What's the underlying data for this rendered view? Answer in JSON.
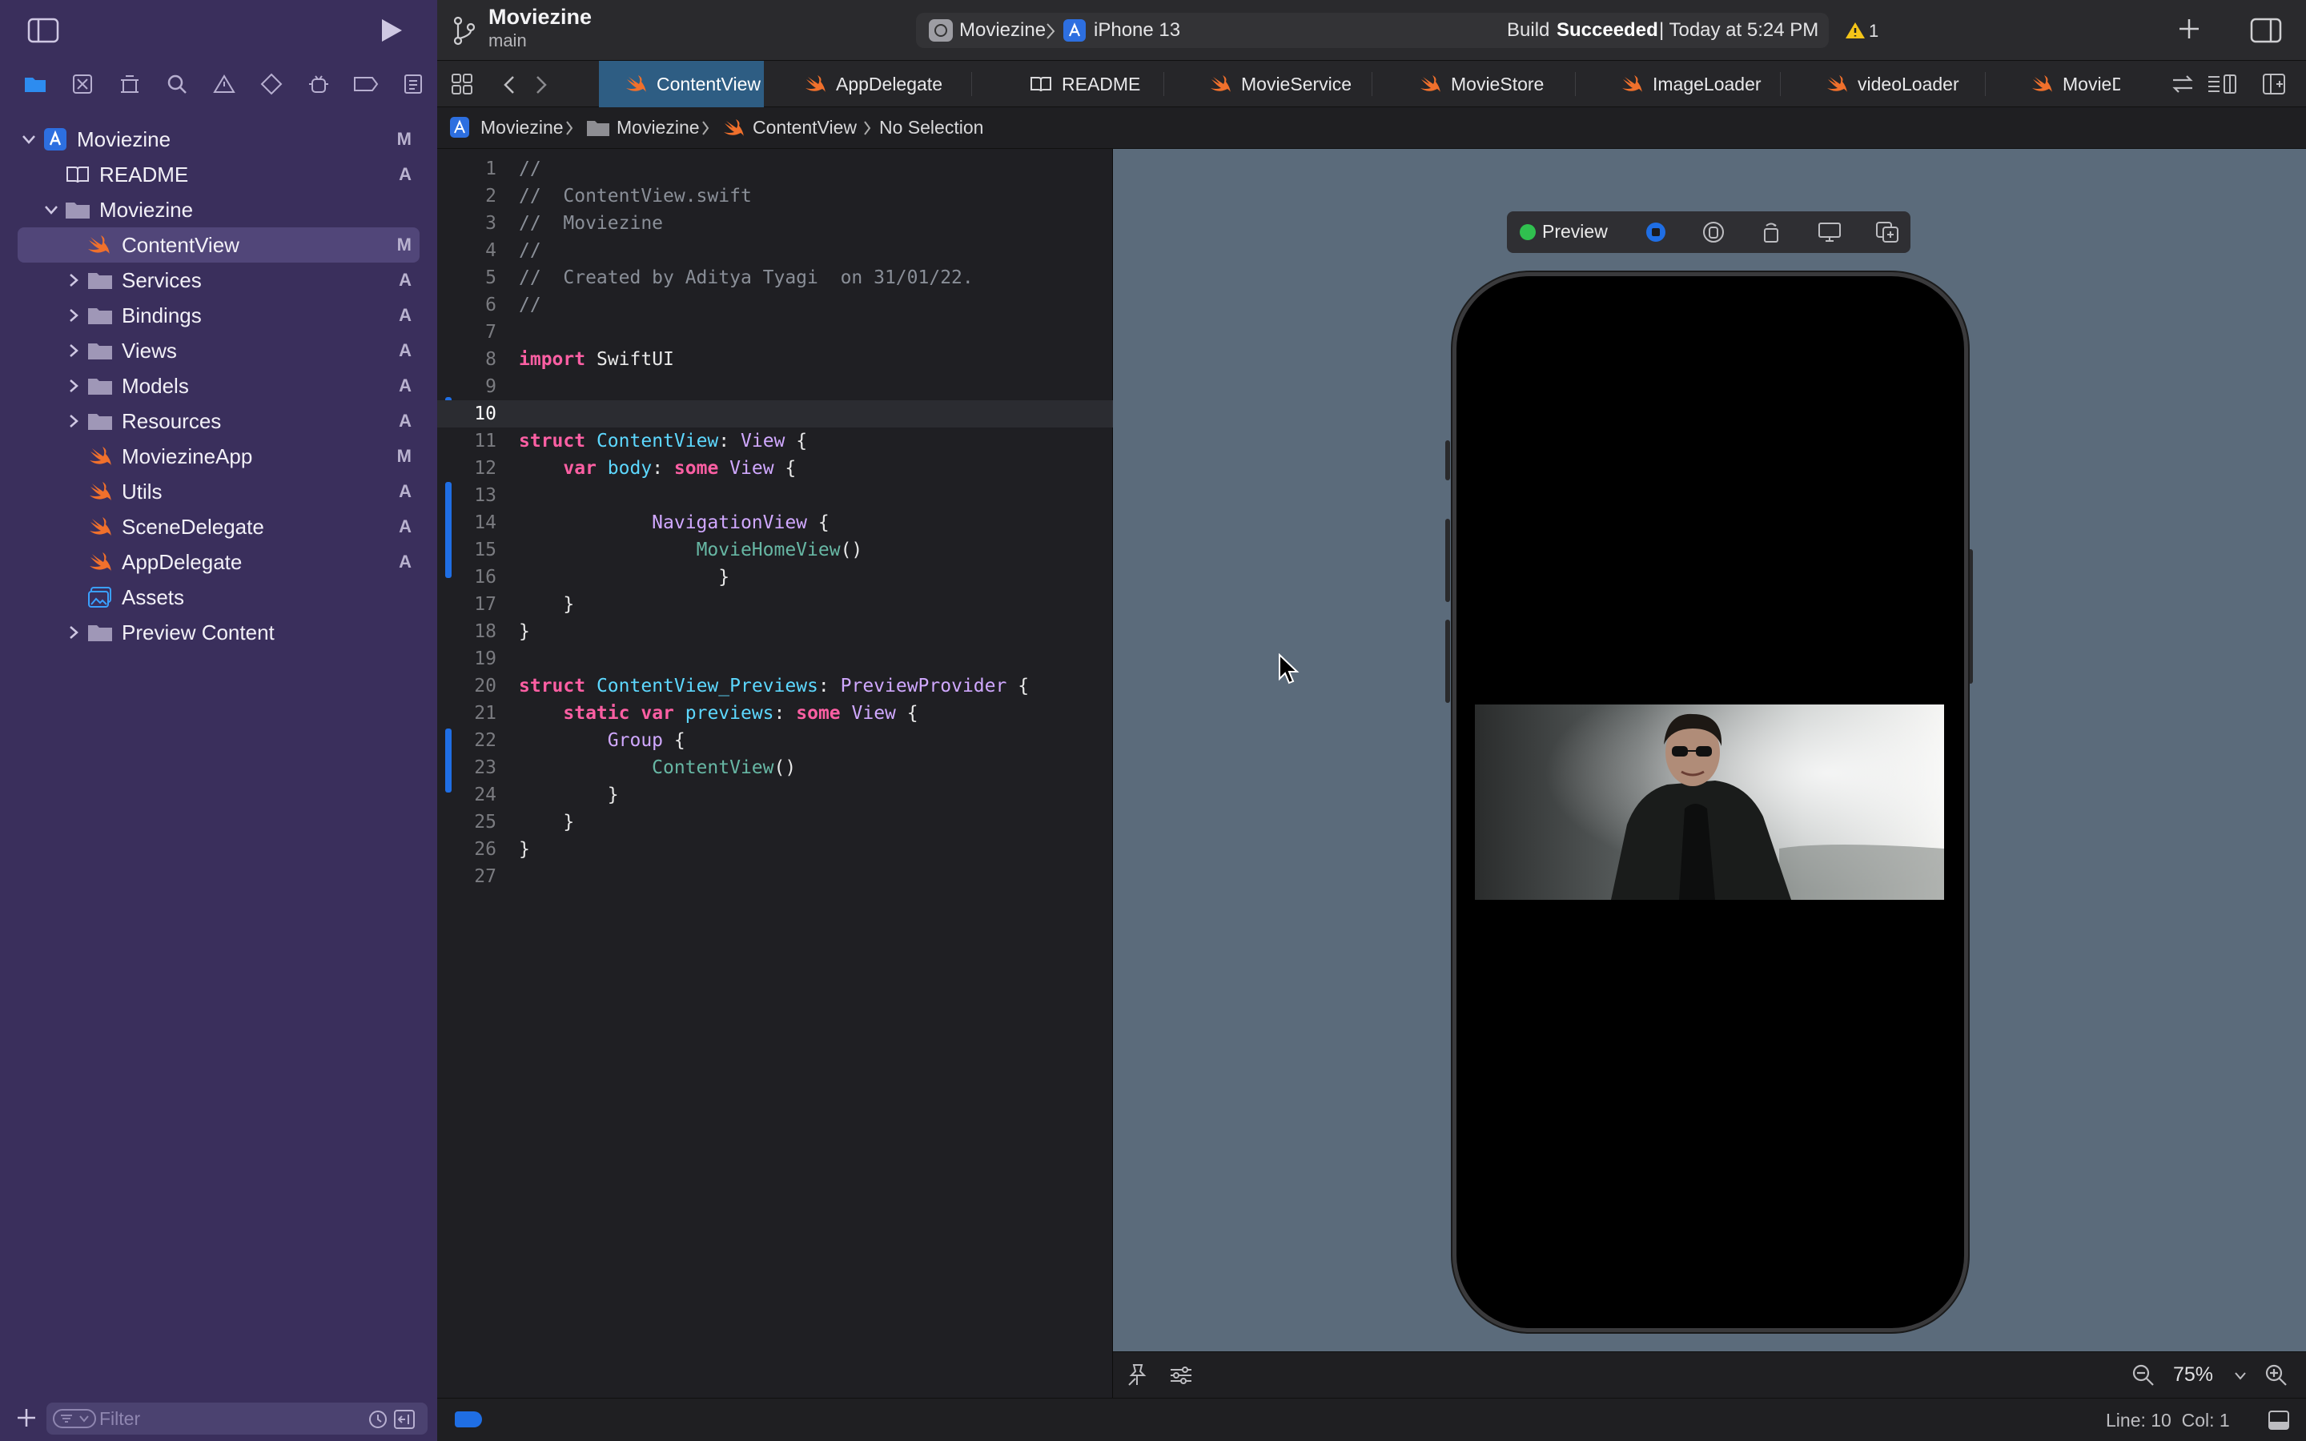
{
  "project": {
    "name": "Moviezine",
    "branch": "main"
  },
  "activity": {
    "scheme": "Moviezine",
    "device": "iPhone 13",
    "status_prefix": "Build",
    "status_bold": "Succeeded",
    "status_time": "| Today at 5:24 PM",
    "warnings": "1"
  },
  "tabs": [
    {
      "label": "ContentView"
    },
    {
      "label": "AppDelegate"
    },
    {
      "label": "README"
    },
    {
      "label": "MovieService"
    },
    {
      "label": "MovieStore"
    },
    {
      "label": "ImageLoader"
    },
    {
      "label": "videoLoader"
    },
    {
      "label": "MovieDetailState"
    }
  ],
  "jumpbar": {
    "project": "Moviezine",
    "group": "Moviezine",
    "file": "ContentView",
    "selection": "No Selection"
  },
  "navigator": {
    "items": [
      {
        "label": "Moviezine",
        "badge": "M"
      },
      {
        "label": "README",
        "badge": "A"
      },
      {
        "label": "Moviezine",
        "badge": ""
      },
      {
        "label": "ContentView",
        "badge": "M"
      },
      {
        "label": "Services",
        "badge": "A"
      },
      {
        "label": "Bindings",
        "badge": "A"
      },
      {
        "label": "Views",
        "badge": "A"
      },
      {
        "label": "Models",
        "badge": "A"
      },
      {
        "label": "Resources",
        "badge": "A"
      },
      {
        "label": "MoviezineApp",
        "badge": "M"
      },
      {
        "label": "Utils",
        "badge": "A"
      },
      {
        "label": "SceneDelegate",
        "badge": "A"
      },
      {
        "label": "AppDelegate",
        "badge": "A"
      },
      {
        "label": "Assets",
        "badge": ""
      },
      {
        "label": "Preview Content",
        "badge": ""
      }
    ],
    "filter_placeholder": "Filter"
  },
  "code": {
    "line_numbers": [
      "1",
      "2",
      "3",
      "4",
      "5",
      "6",
      "7",
      "8",
      "9",
      "10",
      "11",
      "12",
      "13",
      "14",
      "15",
      "16",
      "17",
      "18",
      "19",
      "20",
      "21",
      "22",
      "23",
      "24",
      "25",
      "26",
      "27"
    ],
    "l1": "//",
    "l2": "//  ContentView.swift",
    "l3": "//  Moviezine",
    "l4": "//",
    "l5": "//  Created by Aditya Tyagi  on 31/01/22.",
    "l6": "//",
    "import_kw": "import",
    "import_mod": "SwiftUI",
    "struct_kw": "struct",
    "cv_name": "ContentView",
    "colon": ":",
    "view_type": "View",
    "open_brace": "{",
    "close_brace": "}",
    "var_kw": "var",
    "body_name": "body",
    "some_kw": "some",
    "nav_view": "NavigationView",
    "movie_home": "MovieHomeView",
    "parens": "()",
    "previews_struct": "ContentView_Previews",
    "preview_provider": "PreviewProvider",
    "static_kw": "static",
    "previews_name": "previews",
    "group_name": "Group",
    "cv_call": "ContentView"
  },
  "preview": {
    "label": "Preview",
    "zoom": "75%"
  },
  "status": {
    "position": "Line: 10  Col: 1"
  },
  "colors": {
    "sidebar": "#3a2f5c",
    "accent": "#2e5d83",
    "swift_icon": "#f0702c",
    "change_bar": "#1f6ee4"
  }
}
